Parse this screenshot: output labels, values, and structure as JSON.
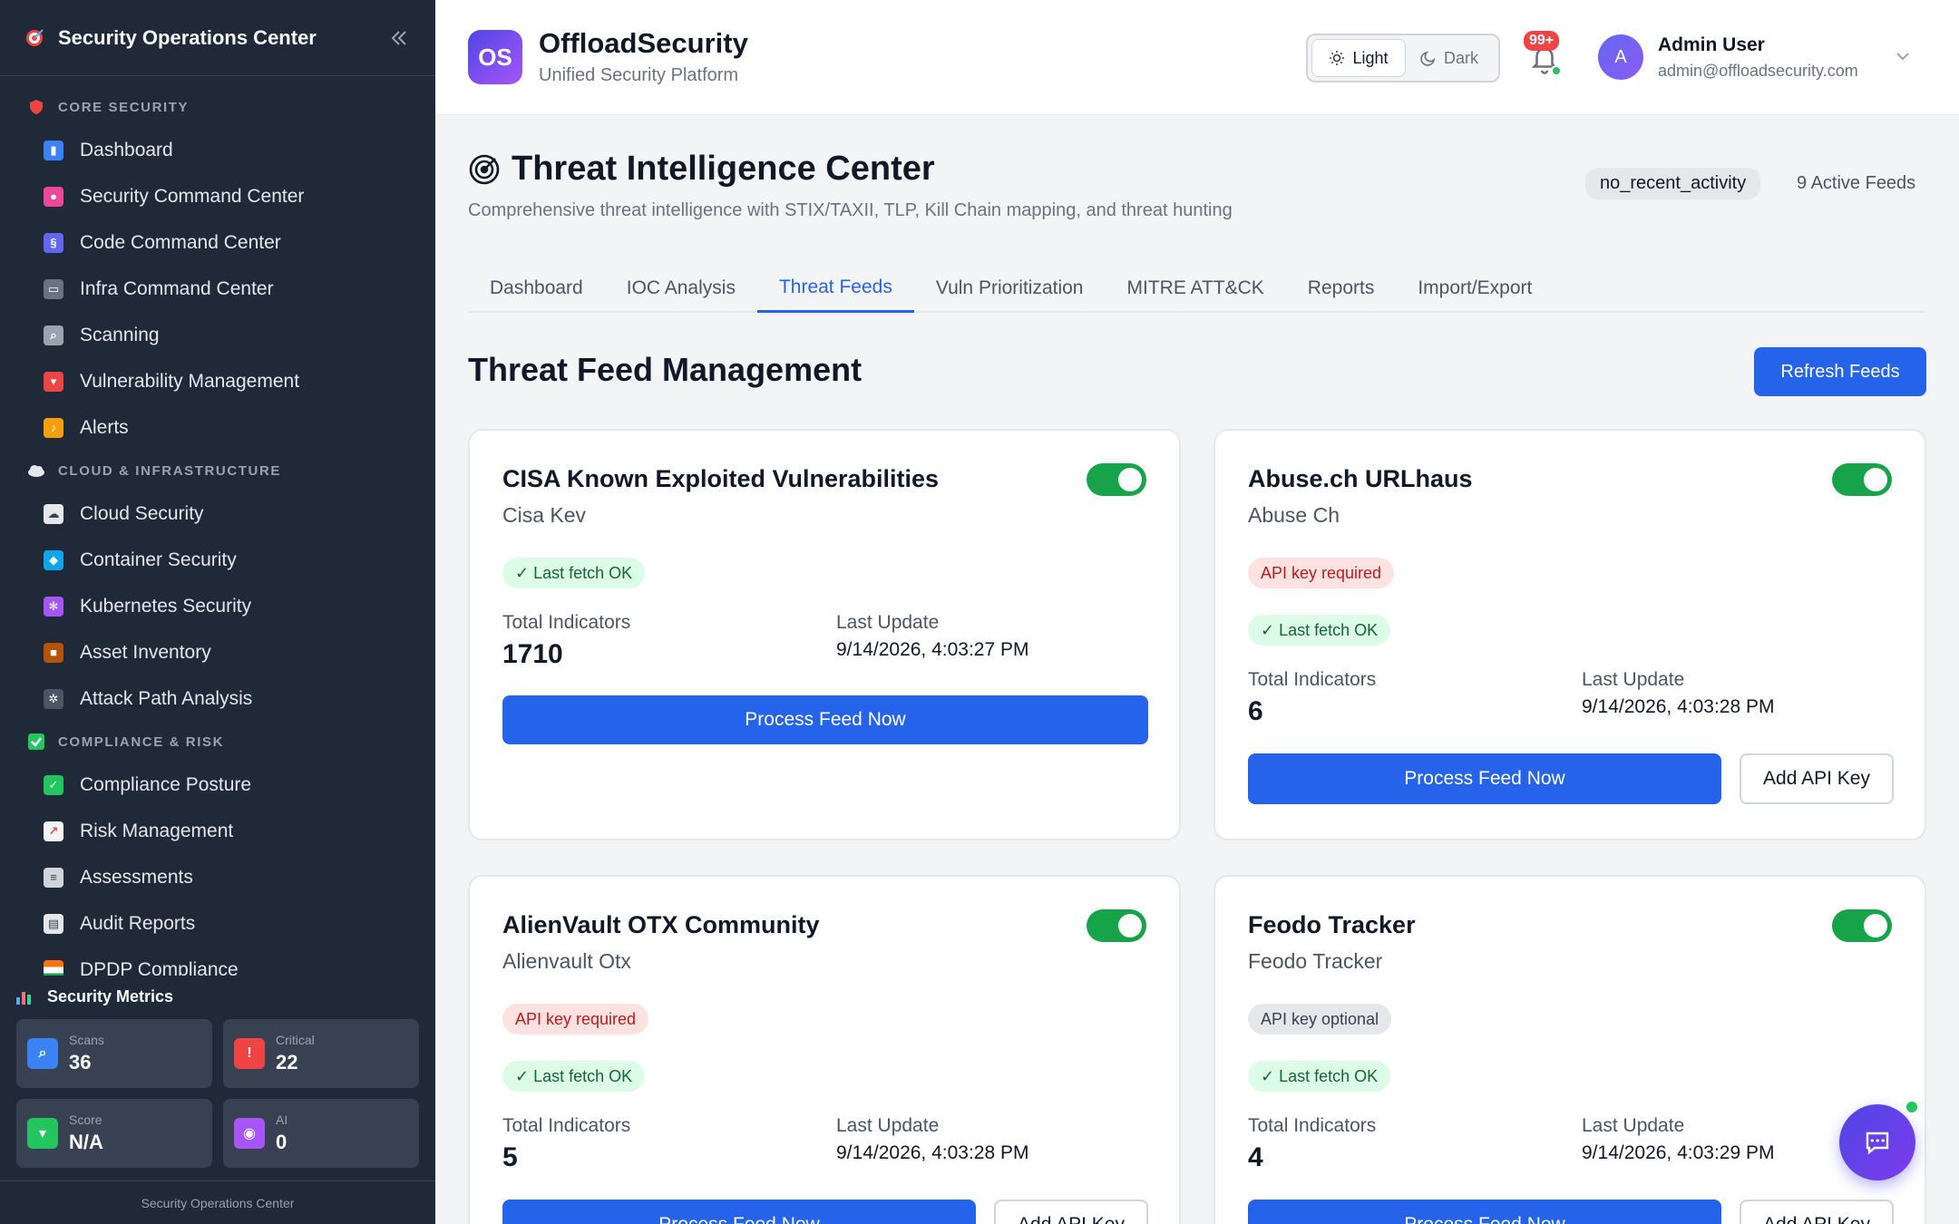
{
  "sidebar": {
    "title": "Security Operations Center",
    "sections": [
      {
        "label": "CORE SECURITY",
        "items": [
          "Dashboard",
          "Security Command Center",
          "Code Command Center",
          "Infra Command Center",
          "Scanning",
          "Vulnerability Management",
          "Alerts"
        ]
      },
      {
        "label": "CLOUD & INFRASTRUCTURE",
        "items": [
          "Cloud Security",
          "Container Security",
          "Kubernetes Security",
          "Asset Inventory",
          "Attack Path Analysis"
        ]
      },
      {
        "label": "COMPLIANCE & RISK",
        "items": [
          "Compliance Posture",
          "Risk Management",
          "Assessments",
          "Audit Reports",
          "DPDP Compliance"
        ]
      }
    ],
    "metrics_title": "Security Metrics",
    "metrics": [
      {
        "label": "Scans",
        "value": "36"
      },
      {
        "label": "Critical",
        "value": "22"
      },
      {
        "label": "Score",
        "value": "N/A"
      },
      {
        "label": "AI",
        "value": "0"
      }
    ],
    "footer": "Security Operations Center"
  },
  "header": {
    "logo_text": "OS",
    "brand": "OffloadSecurity",
    "tagline": "Unified Security Platform",
    "theme_light": "Light",
    "theme_dark": "Dark",
    "notif_badge": "99+",
    "avatar_initial": "A",
    "user_name": "Admin User",
    "user_email": "admin@offloadsecurity.com"
  },
  "page": {
    "title": "Threat Intelligence Center",
    "subtitle": "Comprehensive threat intelligence with STIX/TAXII, TLP, Kill Chain mapping, and threat hunting",
    "status": "no_recent_activity",
    "active_feeds": "9 Active Feeds",
    "tabs": [
      "Dashboard",
      "IOC Analysis",
      "Threat Feeds",
      "Vuln Prioritization",
      "MITRE ATT&CK",
      "Reports",
      "Import/Export"
    ],
    "active_tab": "Threat Feeds",
    "section_title": "Threat Feed Management",
    "refresh_label": "Refresh Feeds"
  },
  "labels": {
    "total_indicators": "Total Indicators",
    "last_update": "Last Update",
    "process": "Process Feed Now",
    "add_key": "Add API Key",
    "fetch_ok": "✓ Last fetch OK",
    "key_required": "API key required",
    "key_optional": "API key optional"
  },
  "feeds": [
    {
      "name": "CISA Known Exploited Vulnerabilities",
      "source": "Cisa Kev",
      "enabled": true,
      "indicators": "1710",
      "last_update": "9/14/2026, 4:03:27 PM"
    },
    {
      "name": "Abuse.ch URLhaus",
      "source": "Abuse Ch",
      "enabled": true,
      "indicators": "6",
      "last_update": "9/14/2026, 4:03:28 PM"
    },
    {
      "name": "AlienVault OTX Community",
      "source": "Alienvault Otx",
      "enabled": true,
      "indicators": "5",
      "last_update": "9/14/2026, 4:03:28 PM"
    },
    {
      "name": "Feodo Tracker",
      "source": "Feodo Tracker",
      "enabled": true,
      "indicators": "4",
      "last_update": "9/14/2026, 4:03:29 PM"
    }
  ],
  "colors": {
    "accent": "#2563eb",
    "sidebar_bg": "#1f2937",
    "success": "#16a34a",
    "danger": "#ef4444"
  }
}
